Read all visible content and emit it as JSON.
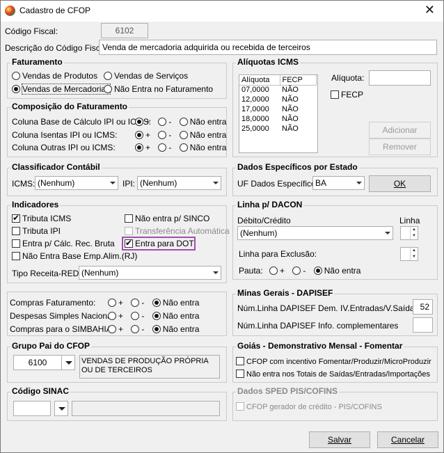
{
  "window": {
    "title": "Cadastro de CFOP",
    "close_glyph": "✕"
  },
  "codigo_fiscal": {
    "label": "Código Fiscal:",
    "value": "6102"
  },
  "descricao": {
    "label": "Descrição do Código Fiscal:",
    "value": "Venda de mercadoria adquirida ou recebida de terceiros"
  },
  "faturamento": {
    "title": "Faturamento",
    "options": [
      "Vendas de Produtos",
      "Vendas de Serviços",
      "Vendas de Mercadorias",
      "Não Entra no Faturamento"
    ],
    "selected": "Vendas de Mercadorias"
  },
  "composicao": {
    "title": "Composição do Faturamento",
    "rows": [
      {
        "label": "Coluna Base de Cálculo IPI ou ICMS:",
        "plus": "+",
        "minus": "-",
        "none": "Não entra",
        "selected": "+"
      },
      {
        "label": "Coluna Isentas IPI ou ICMS:",
        "plus": "+",
        "minus": "-",
        "none": "Não entra",
        "selected": "+"
      },
      {
        "label": "Coluna Outras IPI ou ICMS:",
        "plus": "+",
        "minus": "-",
        "none": "Não entra",
        "selected": "+"
      }
    ]
  },
  "aliquotas": {
    "title": "Alíquotas ICMS",
    "headers": [
      "Alíquota",
      "FECP"
    ],
    "rows": [
      [
        "07,0000",
        "NÃO"
      ],
      [
        "12,0000",
        "NÃO"
      ],
      [
        "17,0000",
        "NÃO"
      ],
      [
        "18,0000",
        "NÃO"
      ],
      [
        "25,0000",
        "NÃO"
      ]
    ],
    "aliquota_label": "Alíquota:",
    "aliquota_value": "",
    "fecp_label": "FECP",
    "add_label": "Adicionar",
    "remove_label": "Remover"
  },
  "classificador": {
    "title": "Classificador Contábil",
    "icms_label": "ICMS:",
    "icms_value": "(Nenhum)",
    "ipi_label": "IPI:",
    "ipi_value": "(Nenhum)"
  },
  "dados_estado": {
    "title": "Dados Específicos por Estado",
    "uf_label": "UF Dados Específicos:",
    "uf_value": "BA",
    "ok_label": "OK"
  },
  "indicadores": {
    "title": "Indicadores",
    "tributa_icms": "Tributa ICMS",
    "tributa_ipi": "Tributa IPI",
    "entra_calc": "Entra p/ Cálc. Rec. Bruta",
    "nao_entra_base": "Não Entra Base Emp.Alim.(RJ)",
    "nao_entra_sinco": "Não entra p/ SINCO",
    "transferencia": "Transferência Automática",
    "entra_dot": "Entra para DOT",
    "highlight_color": "#a24db0",
    "tipo_label": "Tipo Receita-REDF:",
    "tipo_value": "(Nenhum)"
  },
  "dacon": {
    "title": "Linha p/ DACON",
    "debito_label": "Débito/Crédito",
    "linha_label": "Linha",
    "debito_value": "(Nenhum)",
    "exclusao_label": "Linha para Exclusão:",
    "pauta_label": "Pauta:",
    "plus": "+",
    "minus": "-",
    "none": "Não entra"
  },
  "compras": {
    "rows": [
      {
        "label": "Compras Faturamento:",
        "plus": "+",
        "minus": "-",
        "none": "Não entra"
      },
      {
        "label": "Despesas Simples Nacional:",
        "plus": "+",
        "minus": "-",
        "none": "Não entra"
      },
      {
        "label": "Compras para o SIMBAHIA:",
        "plus": "+",
        "minus": "-",
        "none": "Não entra"
      }
    ]
  },
  "minas": {
    "title": "Minas Gerais - DAPISEF",
    "linha1_label": "Núm.Linha DAPISEF Dem. IV.Entradas/V.Saídas",
    "linha1_value": "52",
    "linha2_label": "Núm.Linha DAPISEF Info. complementares",
    "linha2_value": ""
  },
  "grupo_pai": {
    "title": "Grupo Pai do CFOP",
    "code": "6100",
    "description": "VENDAS DE PRODUÇÃO PRÓPRIA OU DE TERCEIROS"
  },
  "goias": {
    "title": "Goiás - Demonstrativo Mensal - Fomentar",
    "opt1": "CFOP com incentivo  Fomentar/Produzir/MicroProduzir",
    "opt2": "Não entra nos Totais de  Saídas/Entradas/Importações"
  },
  "sinac": {
    "title": "Código SINAC",
    "code": "",
    "description": ""
  },
  "sped": {
    "title": "Dados SPED PIS/COFINS",
    "opt1": "CFOP gerador de crédito - PIS/COFINS"
  },
  "footer": {
    "save_label": "Salvar",
    "cancel_label": "Cancelar"
  }
}
